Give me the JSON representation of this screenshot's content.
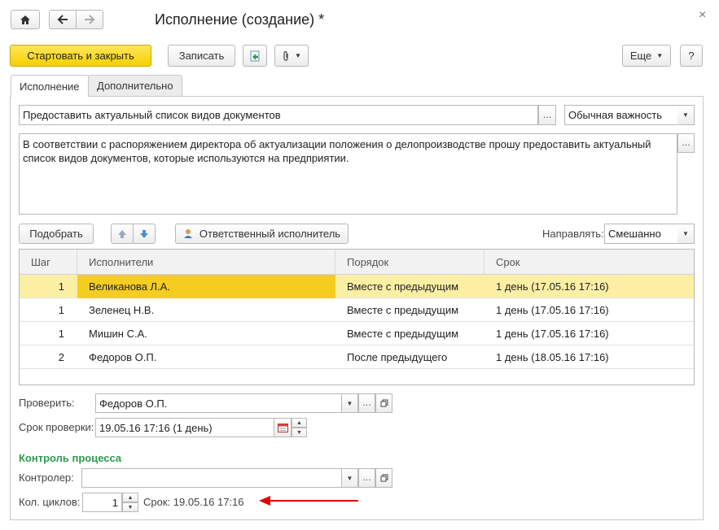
{
  "window": {
    "title": "Исполнение (создание) *",
    "close_glyph": "×"
  },
  "toolbar": {
    "start_close_label": "Стартовать и закрыть",
    "save_label": "Записать",
    "more_label": "Еще",
    "help_label": "?"
  },
  "tabs": [
    {
      "label": "Исполнение",
      "active": true
    },
    {
      "label": "Дополнительно",
      "active": false
    }
  ],
  "form": {
    "subject": "Предоставить актуальный список видов документов",
    "importance": "Обычная важность",
    "description": "В соответствии с распоряжением директора об актуализации положения о делопроизводстве прошу предоставить актуальный список видов документов, которые используются на предприятии.",
    "pick_button": "Подобрать",
    "responsible_button": "Ответственный исполнитель",
    "direct_label": "Направлять:",
    "direct_value": "Смешанно"
  },
  "table": {
    "columns": [
      "Шаг",
      "Исполнители",
      "Порядок",
      "Срок"
    ],
    "rows": [
      {
        "step": "1",
        "executor": "Великанова Л.А.",
        "order": "Вместе с предыдущим",
        "deadline": "1 день (17.05.16 17:16)",
        "selected": true
      },
      {
        "step": "1",
        "executor": "Зеленец Н.В.",
        "order": "Вместе с предыдущим",
        "deadline": "1 день (17.05.16 17:16)",
        "selected": false
      },
      {
        "step": "1",
        "executor": "Мишин С.А.",
        "order": "Вместе с предыдущим",
        "deadline": "1 день (17.05.16 17:16)",
        "selected": false
      },
      {
        "step": "2",
        "executor": "Федоров О.П.",
        "order": "После предыдущего",
        "deadline": "1 день (18.05.16 17:16)",
        "selected": false
      }
    ]
  },
  "check": {
    "verify_label": "Проверить:",
    "verify_value": "Федоров О.П.",
    "deadline_label": "Срок проверки:",
    "deadline_value": "19.05.16 17:16 (1 день)"
  },
  "process": {
    "title": "Контроль процесса",
    "controller_label": "Контролер:",
    "controller_value": "",
    "cycles_label": "Кол. циклов:",
    "cycles_value": "1",
    "term_text": "Срок: 19.05.16 17:16"
  },
  "colors": {
    "accent_yellow": "#f5d000",
    "selected_row": "#fcefa4",
    "current_cell": "#f5cd20",
    "section_green": "#2e9a50",
    "arrow_red": "#e00000"
  }
}
